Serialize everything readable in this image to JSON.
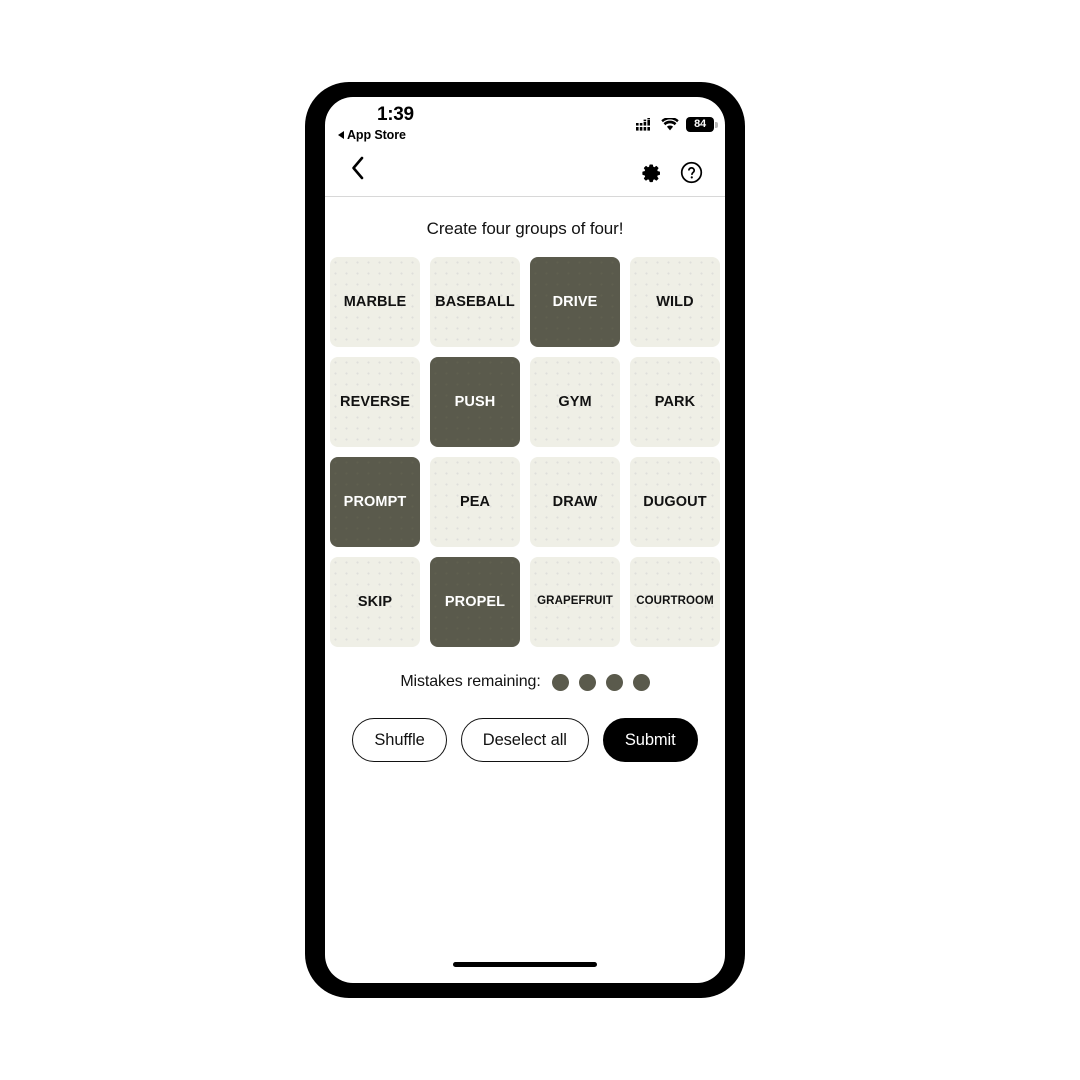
{
  "status_bar": {
    "time": "1:39",
    "return_app": "App Store",
    "return_arrow_icon": "triangle-left-icon",
    "signal_icon": "cellular-signal-icon",
    "wifi_icon": "wifi-icon",
    "battery_percent": "84"
  },
  "nav_bar": {
    "back_icon": "chevron-left-icon",
    "settings_icon": "gear-icon",
    "help_icon": "question-circle-icon"
  },
  "game": {
    "subtitle": "Create four groups of four!",
    "tiles": [
      {
        "label": "MARBLE",
        "selected": false,
        "small": false
      },
      {
        "label": "BASEBALL",
        "selected": false,
        "small": false
      },
      {
        "label": "DRIVE",
        "selected": true,
        "small": false
      },
      {
        "label": "WILD",
        "selected": false,
        "small": false
      },
      {
        "label": "REVERSE",
        "selected": false,
        "small": false
      },
      {
        "label": "PUSH",
        "selected": true,
        "small": false
      },
      {
        "label": "GYM",
        "selected": false,
        "small": false
      },
      {
        "label": "PARK",
        "selected": false,
        "small": false
      },
      {
        "label": "PROMPT",
        "selected": true,
        "small": false
      },
      {
        "label": "PEA",
        "selected": false,
        "small": false
      },
      {
        "label": "DRAW",
        "selected": false,
        "small": false
      },
      {
        "label": "DUGOUT",
        "selected": false,
        "small": false
      },
      {
        "label": "SKIP",
        "selected": false,
        "small": false
      },
      {
        "label": "PROPEL",
        "selected": true,
        "small": false
      },
      {
        "label": "GRAPEFRUIT",
        "selected": false,
        "small": true
      },
      {
        "label": "COURTROOM",
        "selected": false,
        "small": true
      }
    ],
    "mistakes_label": "Mistakes remaining:",
    "mistakes_dots": 4,
    "buttons": {
      "shuffle": "Shuffle",
      "deselect_all": "Deselect all",
      "submit": "Submit"
    }
  },
  "colors": {
    "tile_default": "#efefe6",
    "tile_selected": "#5a5a4c",
    "dot": "#5a5a4c",
    "submit_bg": "#000000",
    "text": "#121212"
  }
}
